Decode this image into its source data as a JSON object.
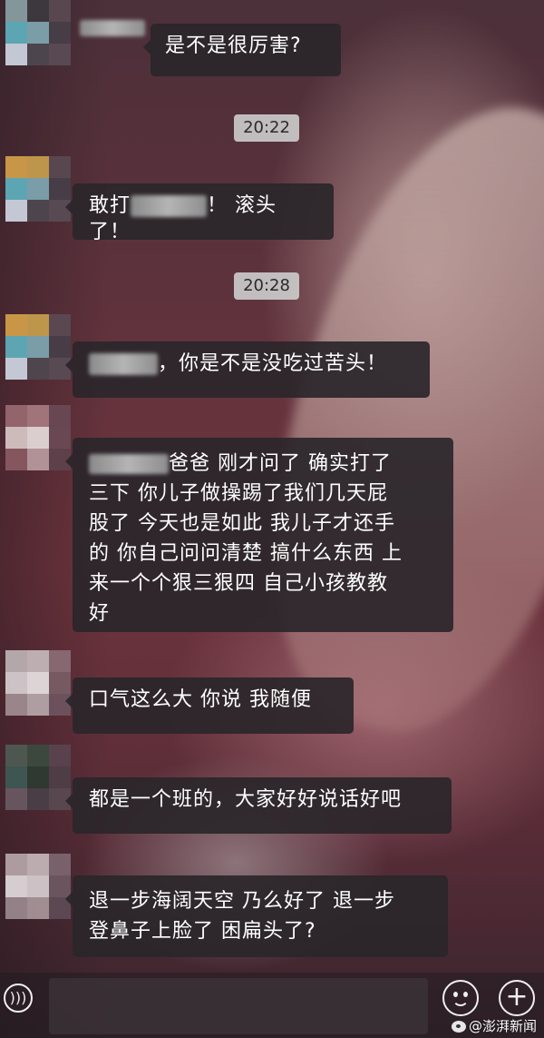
{
  "messages": [
    {
      "kind": "text",
      "text": "是不是很厉害?"
    },
    {
      "kind": "time",
      "text": "20:22"
    },
    {
      "kind": "text",
      "prefix": "敢打",
      "suffix": "！ 滚头了！"
    },
    {
      "kind": "time",
      "text": "20:28"
    },
    {
      "kind": "text",
      "suffix": "，你是不是没吃过苦头！"
    },
    {
      "kind": "text",
      "suffix": "爸爸 刚才问了 确实打了",
      "lines": [
        "三下 你儿子做操踢了我们几天屁",
        "股了 今天也是如此 我儿子才还手",
        "的 你自己问问清楚 搞什么东西 上",
        "来一个个狠三狠四 自己小孩教教",
        "好"
      ]
    },
    {
      "kind": "text",
      "text": "口气这么大 你说 我随便"
    },
    {
      "kind": "text",
      "text": "都是一个班的，大家好好说话好吧"
    },
    {
      "kind": "text",
      "lines": [
        "退一步海阔天空 乃么好了 退一步",
        "登鼻子上脸了 困扁头了?"
      ]
    }
  ],
  "input_bar": {
    "voice_icon": "voice-icon",
    "emoji_icon": "emoji-icon",
    "plus_icon": "plus-icon"
  },
  "watermark": {
    "text": "@澎湃新闻"
  }
}
